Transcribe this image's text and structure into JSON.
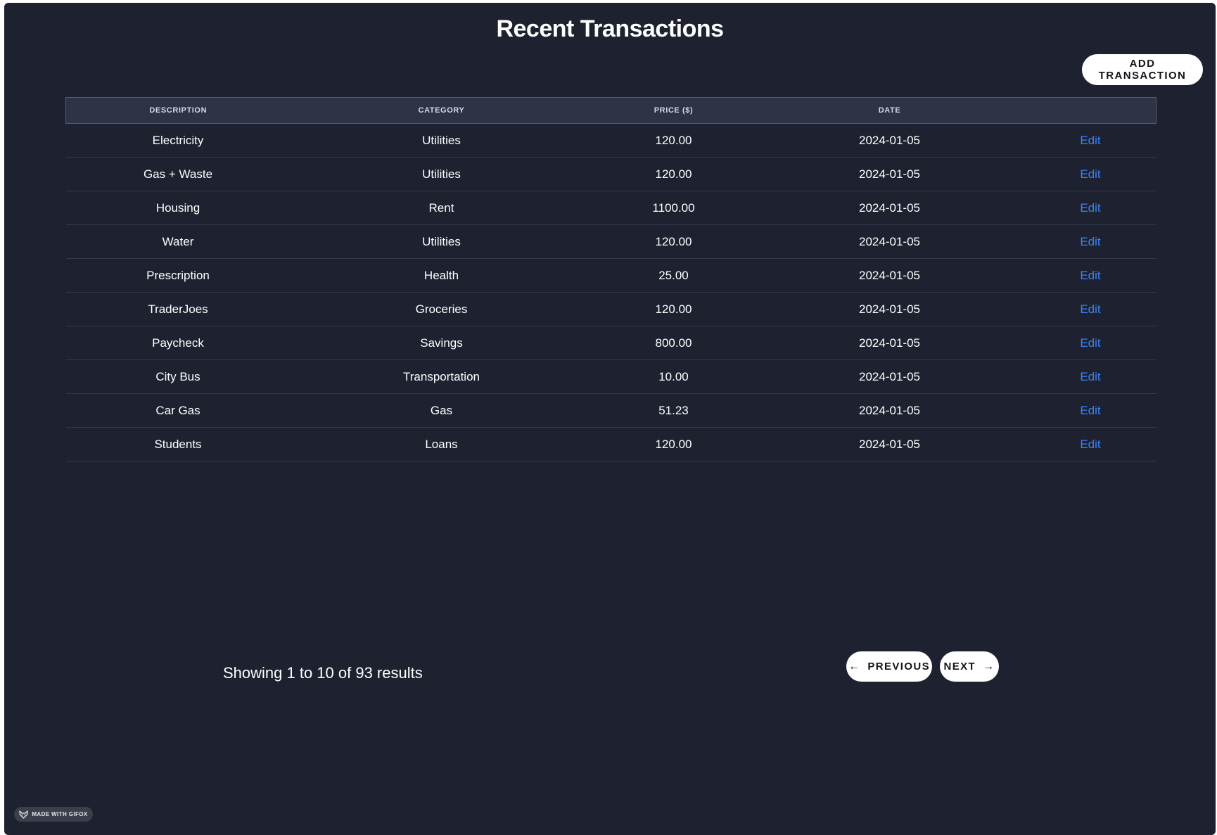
{
  "page": {
    "title": "Recent Transactions"
  },
  "toolbar": {
    "add_label": "ADD TRANSACTION"
  },
  "table": {
    "headers": [
      "DESCRIPTION",
      "CATEGORY",
      "PRICE ($)",
      "DATE",
      ""
    ],
    "rows": [
      {
        "description": "Electricity",
        "category": "Utilities",
        "price": "120.00",
        "date": "2024-01-05",
        "action": "Edit"
      },
      {
        "description": "Gas + Waste",
        "category": "Utilities",
        "price": "120.00",
        "date": "2024-01-05",
        "action": "Edit"
      },
      {
        "description": "Housing",
        "category": "Rent",
        "price": "1100.00",
        "date": "2024-01-05",
        "action": "Edit"
      },
      {
        "description": "Water",
        "category": "Utilities",
        "price": "120.00",
        "date": "2024-01-05",
        "action": "Edit"
      },
      {
        "description": "Prescription",
        "category": "Health",
        "price": "25.00",
        "date": "2024-01-05",
        "action": "Edit"
      },
      {
        "description": "TraderJoes",
        "category": "Groceries",
        "price": "120.00",
        "date": "2024-01-05",
        "action": "Edit"
      },
      {
        "description": "Paycheck",
        "category": "Savings",
        "price": "800.00",
        "date": "2024-01-05",
        "action": "Edit"
      },
      {
        "description": "City Bus",
        "category": "Transportation",
        "price": "10.00",
        "date": "2024-01-05",
        "action": "Edit"
      },
      {
        "description": "Car Gas",
        "category": "Gas",
        "price": "51.23",
        "date": "2024-01-05",
        "action": "Edit"
      },
      {
        "description": "Students",
        "category": "Loans",
        "price": "120.00",
        "date": "2024-01-05",
        "action": "Edit"
      }
    ]
  },
  "pagination": {
    "summary": "Showing 1 to 10 of 93 results",
    "previous_label": "PREVIOUS",
    "next_label": "NEXT",
    "previous_icon": "arrow-left-icon",
    "next_icon": "arrow-right-icon"
  },
  "badge": {
    "label": "MADE WITH GIFOX",
    "icon": "fox-icon"
  },
  "colors": {
    "background": "#1e2230",
    "header_row": "#2e3445",
    "link": "#3b82f6",
    "button": "#ffffff"
  }
}
